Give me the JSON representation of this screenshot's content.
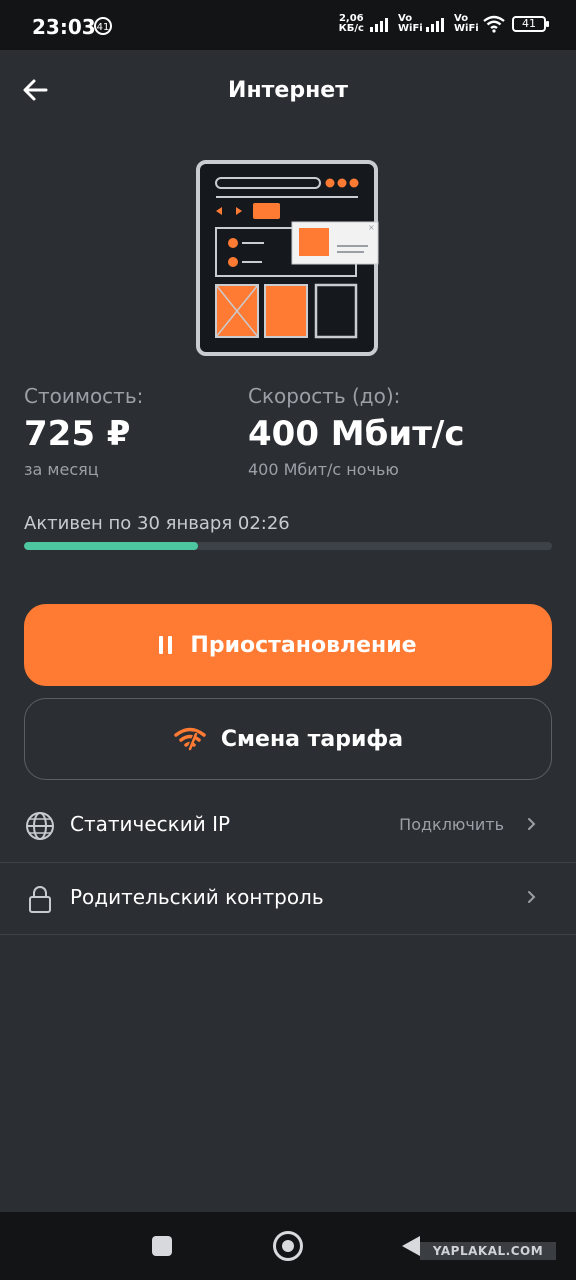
{
  "status_bar": {
    "time": "23:03",
    "notification_badge": "41",
    "net_speed_value": "2,06",
    "net_speed_unit": "КБ/с",
    "vowifi_1": "Vo WiFi",
    "vowifi_2": "Vo WiFi",
    "battery": "41"
  },
  "header": {
    "title": "Интернет",
    "back_icon": "arrow-left-icon"
  },
  "tariff": {
    "cost_label": "Стоимость:",
    "cost_value": "725 ₽",
    "cost_period": "за месяц",
    "speed_label": "Скорость (до):",
    "speed_value": "400 Мбит/с",
    "speed_night": "400 Мбит/с ночью"
  },
  "activity": {
    "text": "Активен по 30 января 02:26",
    "progress_fraction": 0.33,
    "progress_color": "#4cc7a0"
  },
  "buttons": {
    "pause_label": "Приостановление",
    "pause_icon": "pause-icon",
    "change_tariff_label": "Смена тарифа",
    "change_tariff_icon": "wifi-icon"
  },
  "options": [
    {
      "label": "Статический IP",
      "action": "Подключить",
      "icon": "globe-icon"
    },
    {
      "label": "Родительский контроль",
      "action": "",
      "icon": "lock-icon"
    }
  ],
  "colors": {
    "accent": "#ff7a33",
    "background": "#2b2e33",
    "progress": "#4cc7a0"
  },
  "watermark": "YAPLAKAL.COM"
}
